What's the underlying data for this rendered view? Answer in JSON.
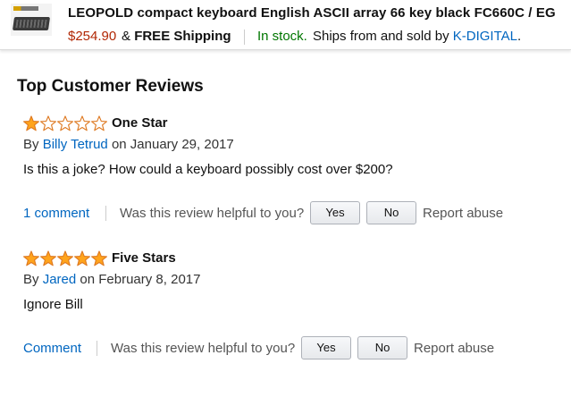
{
  "product_bar": {
    "title": "LEOPOLD compact keyboard English ASCII array 66 key black FC660C / EG",
    "price": "$254.90",
    "shipping_prefix": "&",
    "shipping": "FREE Shipping",
    "stock": "In stock.",
    "ships_text": "Ships from and sold by",
    "seller": "K-DIGITAL",
    "ships_suffix": "."
  },
  "section_heading": "Top Customer Reviews",
  "reviews": [
    {
      "rating": 1,
      "rating_max": 5,
      "title": "One Star",
      "by": "By",
      "author": "Billy Tetrud",
      "date": "on January 29, 2017",
      "body": "Is this a joke? How could a keyboard possibly cost over $200?",
      "comment_link": "1 comment",
      "helpful_prompt": "Was this review helpful to you?",
      "yes_label": "Yes",
      "no_label": "No",
      "report_label": "Report abuse"
    },
    {
      "rating": 5,
      "rating_max": 5,
      "title": "Five Stars",
      "by": "By",
      "author": "Jared",
      "date": "on February 8, 2017",
      "body": "Ignore Bill",
      "comment_link": "Comment",
      "helpful_prompt": "Was this review helpful to you?",
      "yes_label": "Yes",
      "no_label": "No",
      "report_label": "Report abuse"
    }
  ],
  "colors": {
    "star_fill": "#ffa41c",
    "star_outline": "#de7921",
    "link": "#0066c0",
    "price": "#b12704",
    "in_stock": "#007600"
  },
  "icons": {
    "product": "keyboard-thumbnail",
    "rating": "star-icon"
  }
}
